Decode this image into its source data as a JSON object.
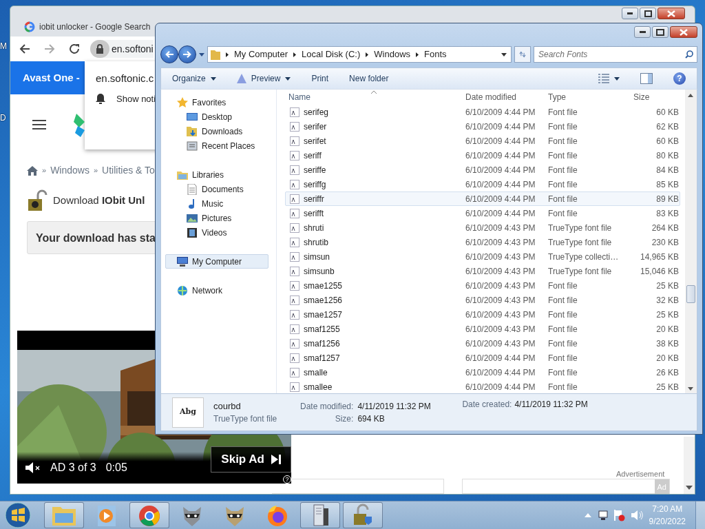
{
  "desktop": {
    "icon_labels": [
      "M",
      "D"
    ]
  },
  "browser": {
    "tabs": [
      {
        "title": "iobit unlocker - Google Search",
        "selected": false
      }
    ],
    "address": "en.softoni",
    "notification": {
      "site": "en.softonic.c",
      "text": "Show noti"
    },
    "banner": "Avast One -",
    "breadcrumb": [
      {
        "separator": "»",
        "label": "Windows"
      },
      {
        "separator": "»",
        "label": "Utilities & To"
      }
    ],
    "heading": "Download **IObit Unl**",
    "alert": "Your download has sta",
    "advertisement_label": "Advertisement",
    "ad_badge": "Ad"
  },
  "video_ad": {
    "muted": true,
    "counter": "AD 3 of 3",
    "time": "0:05",
    "skip": "Skip Ad",
    "help": "?"
  },
  "explorer": {
    "breadcrumb": [
      "My Computer",
      "Local Disk (C:)",
      "Windows",
      "Fonts"
    ],
    "search": {
      "placeholder": "Search Fonts"
    },
    "toolbar": [
      {
        "label": "Organize",
        "dropdown": true
      },
      {
        "label": "Preview",
        "dropdown": true
      },
      {
        "label": "Print",
        "dropdown": false
      },
      {
        "label": "New folder",
        "dropdown": false
      }
    ],
    "help": "?",
    "sidebar": {
      "items": [
        {
          "label": "Favorites",
          "kind": "favorites",
          "selected": false,
          "children": [
            {
              "label": "Desktop",
              "kind": "desktop",
              "selected": false
            },
            {
              "label": "Downloads",
              "kind": "downloads",
              "selected": false
            },
            {
              "label": "Recent Places",
              "kind": "recent",
              "selected": false
            }
          ]
        },
        {
          "label": "Libraries",
          "kind": "libraries",
          "selected": false,
          "children": [
            {
              "label": "Documents",
              "kind": "documents",
              "selected": false
            },
            {
              "label": "Music",
              "kind": "music",
              "selected": false
            },
            {
              "label": "Pictures",
              "kind": "pictures",
              "selected": false
            },
            {
              "label": "Videos",
              "kind": "videos",
              "selected": false
            }
          ]
        },
        {
          "label": "My Computer",
          "kind": "computer",
          "selected": true
        },
        {
          "label": "Network",
          "kind": "network",
          "selected": false
        }
      ]
    },
    "table": {
      "columns": [
        "Name",
        "Date modified",
        "Type",
        "Size"
      ],
      "rows": [
        {
          "name": "serifeg",
          "date": "6/10/2009 4:44 PM",
          "type": "Font file",
          "size": "60 KB",
          "hovered": false
        },
        {
          "name": "serifer",
          "date": "6/10/2009 4:44 PM",
          "type": "Font file",
          "size": "62 KB",
          "hovered": false
        },
        {
          "name": "serifet",
          "date": "6/10/2009 4:44 PM",
          "type": "Font file",
          "size": "60 KB",
          "hovered": false
        },
        {
          "name": "seriff",
          "date": "6/10/2009 4:44 PM",
          "type": "Font file",
          "size": "80 KB",
          "hovered": false
        },
        {
          "name": "seriffe",
          "date": "6/10/2009 4:44 PM",
          "type": "Font file",
          "size": "84 KB",
          "hovered": false
        },
        {
          "name": "seriffg",
          "date": "6/10/2009 4:44 PM",
          "type": "Font file",
          "size": "85 KB",
          "hovered": false
        },
        {
          "name": "seriffr",
          "date": "6/10/2009 4:44 PM",
          "type": "Font file",
          "size": "89 KB",
          "hovered": true
        },
        {
          "name": "serifft",
          "date": "6/10/2009 4:44 PM",
          "type": "Font file",
          "size": "83 KB",
          "hovered": false
        },
        {
          "name": "shruti",
          "date": "6/10/2009 4:43 PM",
          "type": "TrueType font file",
          "size": "264 KB",
          "hovered": false
        },
        {
          "name": "shrutib",
          "date": "6/10/2009 4:43 PM",
          "type": "TrueType font file",
          "size": "230 KB",
          "hovered": false
        },
        {
          "name": "simsun",
          "date": "6/10/2009 4:43 PM",
          "type": "TrueType collecti…",
          "size": "14,965 KB",
          "hovered": false
        },
        {
          "name": "simsunb",
          "date": "6/10/2009 4:43 PM",
          "type": "TrueType font file",
          "size": "15,046 KB",
          "hovered": false
        },
        {
          "name": "smae1255",
          "date": "6/10/2009 4:43 PM",
          "type": "Font file",
          "size": "25 KB",
          "hovered": false
        },
        {
          "name": "smae1256",
          "date": "6/10/2009 4:43 PM",
          "type": "Font file",
          "size": "32 KB",
          "hovered": false
        },
        {
          "name": "smae1257",
          "date": "6/10/2009 4:43 PM",
          "type": "Font file",
          "size": "25 KB",
          "hovered": false
        },
        {
          "name": "smaf1255",
          "date": "6/10/2009 4:43 PM",
          "type": "Font file",
          "size": "20 KB",
          "hovered": false
        },
        {
          "name": "smaf1256",
          "date": "6/10/2009 4:43 PM",
          "type": "Font file",
          "size": "38 KB",
          "hovered": false
        },
        {
          "name": "smaf1257",
          "date": "6/10/2009 4:44 PM",
          "type": "Font file",
          "size": "20 KB",
          "hovered": false
        },
        {
          "name": "smalle",
          "date": "6/10/2009 4:44 PM",
          "type": "Font file",
          "size": "26 KB",
          "hovered": false
        },
        {
          "name": "smallee",
          "date": "6/10/2009 4:44 PM",
          "type": "Font file",
          "size": "25 KB",
          "hovered": false
        }
      ]
    },
    "details": {
      "thumbnail_text": "Abg",
      "name": "courbd",
      "type": "TrueType font file",
      "fields": [
        {
          "label": "Date modified:",
          "value": "4/11/2019 11:32 PM"
        },
        {
          "label": "Size:",
          "value": "694 KB"
        },
        {
          "label": "Date created:",
          "value": "4/11/2019 11:32 PM"
        }
      ]
    }
  },
  "taskbar": {
    "buttons": [
      {
        "kind": "folder",
        "active": true
      },
      {
        "kind": "media",
        "active": false
      },
      {
        "kind": "chrome",
        "active": true
      },
      {
        "kind": "raccoon",
        "active": false
      },
      {
        "kind": "raccoon2",
        "active": false
      },
      {
        "kind": "firefox",
        "active": false
      },
      {
        "kind": "server",
        "active": true
      },
      {
        "kind": "lock",
        "active": true
      }
    ],
    "time": "7:20 AM",
    "date": "9/20/2022"
  }
}
